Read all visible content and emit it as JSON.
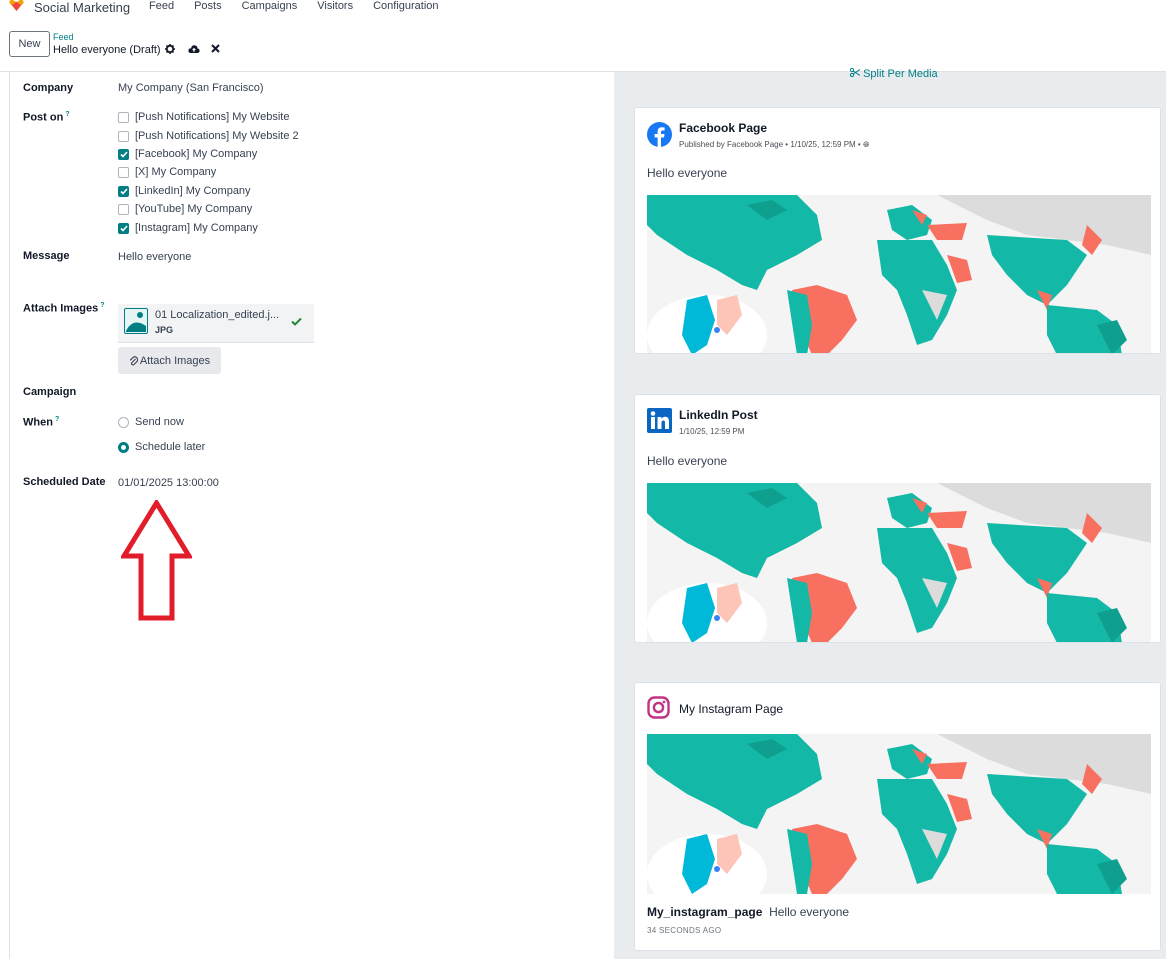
{
  "app": {
    "name": "Social Marketing",
    "menu": [
      "Feed",
      "Posts",
      "Campaigns",
      "Visitors",
      "Configuration"
    ]
  },
  "control": {
    "new_label": "New",
    "breadcrumb": "Feed",
    "record_title": "Hello everyone (Draft)"
  },
  "form": {
    "company_label": "Company",
    "company_value": "My Company (San Francisco)",
    "post_on_label": "Post on",
    "help_mark": "?",
    "accounts": [
      {
        "label": "[Push Notifications] My Website",
        "checked": false
      },
      {
        "label": "[Push Notifications] My Website 2",
        "checked": false
      },
      {
        "label": "[Facebook] My Company",
        "checked": true
      },
      {
        "label": "[X] My Company",
        "checked": false
      },
      {
        "label": "[LinkedIn] My Company",
        "checked": true
      },
      {
        "label": "[YouTube] My Company",
        "checked": false
      },
      {
        "label": "[Instagram] My Company",
        "checked": true
      }
    ],
    "message_label": "Message",
    "message_value": "Hello everyone",
    "attach_label": "Attach Images",
    "attachment": {
      "name": "01 Localization_edited.j...",
      "ext": "JPG"
    },
    "attach_button": "Attach Images",
    "campaign_label": "Campaign",
    "when_label": "When",
    "when_options": [
      {
        "label": "Send now",
        "selected": false
      },
      {
        "label": "Schedule later",
        "selected": true
      }
    ],
    "scheduled_label": "Scheduled Date",
    "scheduled_value": "01/01/2025 13:00:00"
  },
  "preview": {
    "split_label": "Split Per Media",
    "facebook": {
      "title": "Facebook Page",
      "subtitle": "Published by Facebook Page • 1/10/25, 12:59 PM •",
      "message": "Hello everyone"
    },
    "linkedin": {
      "title": "LinkedIn Post",
      "subtitle": "1/10/25, 12:59 PM",
      "message": "Hello everyone"
    },
    "instagram": {
      "title": "My Instagram Page",
      "handle": "My_instagram_page",
      "message": "Hello everyone",
      "time": "34 SECONDS AGO"
    }
  },
  "colors": {
    "accent": "#017e84",
    "map_teal": "#14b8a6",
    "map_coral": "#f87060",
    "arrow_red": "#e11d2a"
  }
}
